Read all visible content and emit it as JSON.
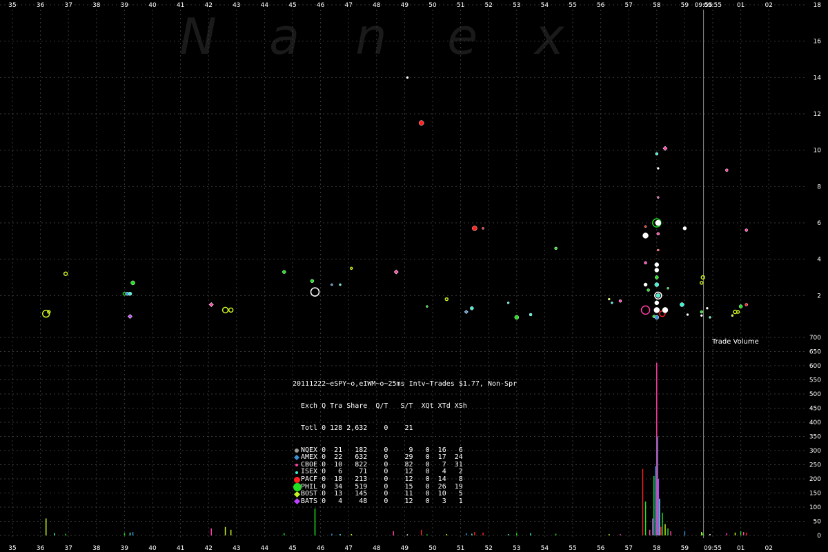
{
  "watermark": [
    "N",
    "a",
    "n",
    "e",
    "x"
  ],
  "time_label": "09:55",
  "volume_label": "Trade Volume",
  "legend": {
    "title": "20111222~eSPY~o,eIWM~o~25ms Intv~Trades $1.77, Non-Spr",
    "header": "Exch Q Tra Share  Q/T   S/T  XQt XTd XSh",
    "total": "Totl 0 128 2,632    0    21",
    "rows": [
      {
        "text": "NQEX 0  21   182    0     9   0  16   6",
        "color": "#9a9a9a",
        "shape": "circle",
        "size": 3
      },
      {
        "text": "AMEX 0  22   632    0    29   0  17  24",
        "color": "#3a8fd8",
        "shape": "diamond",
        "size": 3
      },
      {
        "text": "CBOE 0  10   822    0    82   0   7  31",
        "color": "#ff3fa6",
        "shape": "circle",
        "size": 2
      },
      {
        "text": "ISEX 0   6    71    0    12   0   4   2",
        "color": "#40f0d0",
        "shape": "circle",
        "size": 2
      },
      {
        "text": "PACF 0  18   213    0    12   0  14   8",
        "color": "#ff2020",
        "shape": "circle",
        "size": 4.5
      },
      {
        "text": "PHIL 0  34   519    0    15   0  26  19",
        "color": "#20e020",
        "shape": "circle",
        "size": 6
      },
      {
        "text": "BOST 0  13   145    0    11   0  10   5",
        "color": "#c8f020",
        "shape": "diamond",
        "size": 3.5
      },
      {
        "text": "BATS 0   4    48    0    12   0   3   1",
        "color": "#c040ff",
        "shape": "diamond",
        "size": 3.5
      }
    ]
  },
  "chart_data": {
    "type": "scatter",
    "x_ticks": [
      "35",
      "36",
      "37",
      "38",
      "39",
      "40",
      "41",
      "42",
      "43",
      "44",
      "45",
      "46",
      "47",
      "48",
      "49",
      "50",
      "51",
      "52",
      "53",
      "54",
      "55",
      "56",
      "57",
      "58",
      "59",
      "09:55",
      "01",
      "02"
    ],
    "upper_y_ticks": [
      2,
      4,
      6,
      8,
      10,
      12,
      14,
      16,
      18
    ],
    "upper_ylim": [
      0,
      18
    ],
    "lower_y_ticks": [
      0,
      50,
      100,
      150,
      200,
      250,
      300,
      350,
      400,
      450,
      500,
      550,
      600,
      650,
      700
    ],
    "lower_ylim": [
      0,
      700
    ],
    "trades": [
      {
        "t": 36.2,
        "y": 1.0,
        "c": "#c8f020",
        "r": 5,
        "f": "ring"
      },
      {
        "t": 36.3,
        "y": 1.1,
        "c": "#c8f020",
        "r": 2,
        "f": "ring"
      },
      {
        "t": 36.9,
        "y": 3.2,
        "c": "#c8f020",
        "r": 2.5,
        "f": "ring"
      },
      {
        "t": 39.0,
        "y": 2.1,
        "c": "#20e020",
        "r": 2,
        "f": "ring"
      },
      {
        "t": 39.1,
        "y": 2.1,
        "c": "#3a8fd8",
        "r": 2.5,
        "f": "solid"
      },
      {
        "t": 39.2,
        "y": 2.1,
        "c": "#40f0d0",
        "r": 2.5,
        "f": "solid"
      },
      {
        "t": 39.3,
        "y": 2.7,
        "c": "#20e020",
        "r": 3,
        "f": "solid"
      },
      {
        "t": 39.2,
        "y": 0.85,
        "c": "#c040ff",
        "r": 3,
        "f": "diamond"
      },
      {
        "t": 42.1,
        "y": 1.5,
        "c": "#ff3fa6",
        "r": 3,
        "f": "diamond"
      },
      {
        "t": 42.6,
        "y": 1.2,
        "c": "#c8f020",
        "r": 4,
        "f": "ring"
      },
      {
        "t": 42.8,
        "y": 1.2,
        "c": "#c8f020",
        "r": 3,
        "f": "ring"
      },
      {
        "t": 44.7,
        "y": 3.3,
        "c": "#20e020",
        "r": 2.5,
        "f": "solid"
      },
      {
        "t": 45.7,
        "y": 2.8,
        "c": "#20e020",
        "r": 2.5,
        "f": "solid"
      },
      {
        "t": 45.8,
        "y": 2.2,
        "c": "#ffffff",
        "r": 6,
        "f": "ring"
      },
      {
        "t": 46.4,
        "y": 2.6,
        "c": "#3a8fd8",
        "r": 1.5,
        "f": "solid"
      },
      {
        "t": 46.7,
        "y": 2.6,
        "c": "#40f0d0",
        "r": 1.5,
        "f": "solid"
      },
      {
        "t": 47.1,
        "y": 3.5,
        "c": "#c8f020",
        "r": 1.5,
        "f": "ring"
      },
      {
        "t": 48.7,
        "y": 3.3,
        "c": "#ff3fa6",
        "r": 3,
        "f": "diamond"
      },
      {
        "t": 49.1,
        "y": 14.0,
        "c": "#ffffff",
        "r": 1.5,
        "f": "solid"
      },
      {
        "t": 49.6,
        "y": 11.5,
        "c": "#ff2020",
        "r": 3.5,
        "f": "solid"
      },
      {
        "t": 49.8,
        "y": 1.4,
        "c": "#20e020",
        "r": 1.5,
        "f": "solid"
      },
      {
        "t": 50.5,
        "y": 1.8,
        "c": "#c8f020",
        "r": 2,
        "f": "ring"
      },
      {
        "t": 51.2,
        "y": 1.1,
        "c": "#3a8fd8",
        "r": 2.5,
        "f": "diamond"
      },
      {
        "t": 51.4,
        "y": 1.3,
        "c": "#40f0d0",
        "r": 2.5,
        "f": "solid"
      },
      {
        "t": 51.5,
        "y": 5.7,
        "c": "#ff2020",
        "r": 3.5,
        "f": "solid"
      },
      {
        "t": 51.8,
        "y": 5.7,
        "c": "#ff2020",
        "r": 1.5,
        "f": "solid"
      },
      {
        "t": 52.7,
        "y": 1.6,
        "c": "#40f0d0",
        "r": 1.5,
        "f": "solid"
      },
      {
        "t": 53.0,
        "y": 0.8,
        "c": "#20e020",
        "r": 3,
        "f": "solid"
      },
      {
        "t": 53.5,
        "y": 0.95,
        "c": "#40f0d0",
        "r": 2,
        "f": "solid"
      },
      {
        "t": 54.4,
        "y": 4.6,
        "c": "#20e020",
        "r": 2,
        "f": "solid"
      },
      {
        "t": 56.3,
        "y": 1.8,
        "c": "#c8f020",
        "r": 1.5,
        "f": "solid"
      },
      {
        "t": 56.4,
        "y": 1.6,
        "c": "#40f0d0",
        "r": 1.5,
        "f": "solid"
      },
      {
        "t": 56.7,
        "y": 1.7,
        "c": "#ff3fa6",
        "r": 2,
        "f": "solid"
      },
      {
        "t": 57.6,
        "y": 1.2,
        "c": "#ff3fa6",
        "r": 6,
        "f": "ring"
      },
      {
        "t": 57.6,
        "y": 5.3,
        "c": "#ffffff",
        "r": 4,
        "f": "solid"
      },
      {
        "t": 57.6,
        "y": 5.8,
        "c": "#ff2020",
        "r": 1.5,
        "f": "solid"
      },
      {
        "t": 57.6,
        "y": 3.8,
        "c": "#ff3fa6",
        "r": 2,
        "f": "solid"
      },
      {
        "t": 57.6,
        "y": 2.6,
        "c": "#ffffff",
        "r": 2.5,
        "f": "solid"
      },
      {
        "t": 57.7,
        "y": 2.3,
        "c": "#20e020",
        "r": 2,
        "f": "solid"
      },
      {
        "t": 57.9,
        "y": 0.85,
        "c": "#20e020",
        "r": 2,
        "f": "solid"
      },
      {
        "t": 58.0,
        "y": 6.0,
        "c": "#20e020",
        "r": 6,
        "f": "ring"
      },
      {
        "t": 58.05,
        "y": 6.0,
        "c": "#ffffff",
        "r": 4,
        "f": "solid"
      },
      {
        "t": 58.0,
        "y": 9.8,
        "c": "#40f0d0",
        "r": 2,
        "f": "solid"
      },
      {
        "t": 58.05,
        "y": 9.0,
        "c": "#ffffff",
        "r": 1.5,
        "f": "solid"
      },
      {
        "t": 58.05,
        "y": 7.4,
        "c": "#ff3fa6",
        "r": 1.5,
        "f": "solid"
      },
      {
        "t": 58.05,
        "y": 5.4,
        "c": "#ff3fa6",
        "r": 2,
        "f": "solid"
      },
      {
        "t": 58.05,
        "y": 4.5,
        "c": "#ff2020",
        "r": 1.5,
        "f": "solid"
      },
      {
        "t": 58.0,
        "y": 3.7,
        "c": "#ffffff",
        "r": 3,
        "f": "solid"
      },
      {
        "t": 58.0,
        "y": 3.4,
        "c": "#ffffff",
        "r": 3,
        "f": "solid"
      },
      {
        "t": 58.0,
        "y": 3.0,
        "c": "#20e020",
        "r": 2.5,
        "f": "solid"
      },
      {
        "t": 58.0,
        "y": 2.6,
        "c": "#40f0d0",
        "r": 3,
        "f": "solid"
      },
      {
        "t": 58.05,
        "y": 2.0,
        "c": "#ffffff",
        "r": 5,
        "f": "ring"
      },
      {
        "t": 58.05,
        "y": 2.0,
        "c": "#40f0d0",
        "r": 3,
        "f": "solid"
      },
      {
        "t": 58.0,
        "y": 1.6,
        "c": "#ffffff",
        "r": 3,
        "f": "solid"
      },
      {
        "t": 58.0,
        "y": 1.2,
        "c": "#ffffff",
        "r": 4,
        "f": "solid"
      },
      {
        "t": 58.0,
        "y": 0.8,
        "c": "#3a8fd8",
        "r": 3,
        "f": "solid"
      },
      {
        "t": 58.2,
        "y": 1.0,
        "c": "#ff2020",
        "r": 4,
        "f": "ring"
      },
      {
        "t": 58.3,
        "y": 1.2,
        "c": "#ffffff",
        "r": 4,
        "f": "solid"
      },
      {
        "t": 58.3,
        "y": 10.1,
        "c": "#ff3fa6",
        "r": 3,
        "f": "diamond"
      },
      {
        "t": 58.4,
        "y": 2.4,
        "c": "#20e020",
        "r": 1.5,
        "f": "solid"
      },
      {
        "t": 59.0,
        "y": 5.7,
        "c": "#ffffff",
        "r": 2.5,
        "f": "solid"
      },
      {
        "t": 58.9,
        "y": 1.5,
        "c": "#40f0d0",
        "r": 3,
        "f": "solid"
      },
      {
        "t": 59.1,
        "y": 0.95,
        "c": "#ffffff",
        "r": 1.5,
        "f": "solid"
      },
      {
        "t": 59.6,
        "y": 1.1,
        "c": "#20e020",
        "r": 2,
        "f": "solid"
      },
      {
        "t": 59.6,
        "y": 0.9,
        "c": "#ffffff",
        "r": 1.5,
        "f": "solid"
      },
      {
        "t": 59.65,
        "y": 3.0,
        "c": "#c8f020",
        "r": 2.5,
        "f": "ring"
      },
      {
        "t": 59.6,
        "y": 2.7,
        "c": "#c8f020",
        "r": 2,
        "f": "ring"
      },
      {
        "t": 59.8,
        "y": 1.3,
        "c": "#ffffff",
        "r": 1.5,
        "f": "solid"
      },
      {
        "t": 59.9,
        "y": 0.8,
        "c": "#40f0d0",
        "r": 1.5,
        "f": "solid"
      },
      {
        "t": 60.5,
        "y": 8.9,
        "c": "#ff3fa6",
        "r": 2,
        "f": "solid"
      },
      {
        "t": 61.2,
        "y": 5.6,
        "c": "#ff3fa6",
        "r": 2,
        "f": "solid"
      },
      {
        "t": 60.7,
        "y": 0.9,
        "c": "#c8f020",
        "r": 1.5,
        "f": "solid"
      },
      {
        "t": 60.8,
        "y": 1.1,
        "c": "#c8f020",
        "r": 2.5,
        "f": "ring"
      },
      {
        "t": 60.9,
        "y": 1.1,
        "c": "#c8f020",
        "r": 2,
        "f": "ring"
      },
      {
        "t": 61.0,
        "y": 1.4,
        "c": "#20e020",
        "r": 2.5,
        "f": "solid"
      },
      {
        "t": 61.2,
        "y": 1.5,
        "c": "#ff2020",
        "r": 2,
        "f": "solid"
      }
    ],
    "volume": [
      {
        "t": 36.2,
        "v": 60,
        "c": "#c8f020"
      },
      {
        "t": 36.5,
        "v": 8,
        "c": "#40f0d0"
      },
      {
        "t": 36.9,
        "v": 6,
        "c": "#20e020"
      },
      {
        "t": 39.0,
        "v": 8,
        "c": "#20e020"
      },
      {
        "t": 39.2,
        "v": 10,
        "c": "#40f0d0"
      },
      {
        "t": 39.3,
        "v": 12,
        "c": "#3a8fd8"
      },
      {
        "t": 42.1,
        "v": 25,
        "c": "#ff3fa6"
      },
      {
        "t": 42.6,
        "v": 30,
        "c": "#c8f020"
      },
      {
        "t": 42.8,
        "v": 20,
        "c": "#c8f020"
      },
      {
        "t": 44.7,
        "v": 8,
        "c": "#20e020"
      },
      {
        "t": 45.8,
        "v": 95,
        "c": "#20e020"
      },
      {
        "t": 46.4,
        "v": 6,
        "c": "#3a8fd8"
      },
      {
        "t": 46.7,
        "v": 5,
        "c": "#40f0d0"
      },
      {
        "t": 47.1,
        "v": 5,
        "c": "#c8f020"
      },
      {
        "t": 48.6,
        "v": 15,
        "c": "#ff3fa6"
      },
      {
        "t": 49.1,
        "v": 4,
        "c": "#ffffff"
      },
      {
        "t": 49.6,
        "v": 20,
        "c": "#ff2020"
      },
      {
        "t": 49.8,
        "v": 4,
        "c": "#20e020"
      },
      {
        "t": 50.5,
        "v": 5,
        "c": "#c8f020"
      },
      {
        "t": 51.2,
        "v": 8,
        "c": "#3a8fd8"
      },
      {
        "t": 51.4,
        "v": 6,
        "c": "#40f0d0"
      },
      {
        "t": 51.5,
        "v": 12,
        "c": "#ff2020"
      },
      {
        "t": 51.8,
        "v": 10,
        "c": "#ff2020"
      },
      {
        "t": 52.7,
        "v": 5,
        "c": "#40f0d0"
      },
      {
        "t": 53.0,
        "v": 8,
        "c": "#20e020"
      },
      {
        "t": 53.5,
        "v": 8,
        "c": "#40f0d0"
      },
      {
        "t": 54.4,
        "v": 6,
        "c": "#20e020"
      },
      {
        "t": 56.3,
        "v": 5,
        "c": "#c8f020"
      },
      {
        "t": 56.7,
        "v": 5,
        "c": "#ff3fa6"
      },
      {
        "t": 57.5,
        "v": 235,
        "c": "#ff2020"
      },
      {
        "t": 57.6,
        "v": 120,
        "c": "#20e020"
      },
      {
        "t": 57.75,
        "v": 20,
        "c": "#ff3fa6"
      },
      {
        "t": 57.85,
        "v": 60,
        "c": "#c040ff"
      },
      {
        "t": 57.9,
        "v": 210,
        "c": "#20e020"
      },
      {
        "t": 57.95,
        "v": 245,
        "c": "#3a8fd8"
      },
      {
        "t": 58.0,
        "v": 610,
        "c": "#ff3fa6"
      },
      {
        "t": 58.03,
        "v": 350,
        "c": "#3a8fd8"
      },
      {
        "t": 58.06,
        "v": 200,
        "c": "#c040ff"
      },
      {
        "t": 58.1,
        "v": 130,
        "c": "#40f0d0"
      },
      {
        "t": 58.15,
        "v": 30,
        "c": "#ff2020"
      },
      {
        "t": 58.2,
        "v": 80,
        "c": "#20e020"
      },
      {
        "t": 58.3,
        "v": 40,
        "c": "#c8f020"
      },
      {
        "t": 58.4,
        "v": 25,
        "c": "#20e020"
      },
      {
        "t": 58.5,
        "v": 15,
        "c": "#ff3fa6"
      },
      {
        "t": 59.0,
        "v": 15,
        "c": "#3a8fd8"
      },
      {
        "t": 59.6,
        "v": 12,
        "c": "#c8f020"
      },
      {
        "t": 59.65,
        "v": 8,
        "c": "#20e020"
      },
      {
        "t": 59.9,
        "v": 5,
        "c": "#ffffff"
      },
      {
        "t": 60.5,
        "v": 8,
        "c": "#ff3fa6"
      },
      {
        "t": 60.8,
        "v": 10,
        "c": "#c8f020"
      },
      {
        "t": 61.0,
        "v": 15,
        "c": "#20e020"
      },
      {
        "t": 61.1,
        "v": 12,
        "c": "#ff3fa6"
      },
      {
        "t": 61.2,
        "v": 10,
        "c": "#ff2020"
      }
    ],
    "vertical_marker_t": 59.67,
    "grid": true
  }
}
